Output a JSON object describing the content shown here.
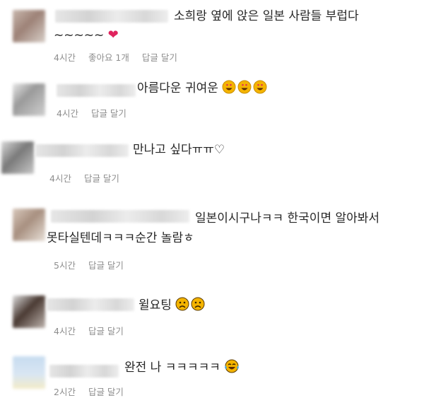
{
  "comments": [
    {
      "text_line1": "소희랑 옆에 앉은 일본 사람들 부럽다",
      "text_line2": "~~~~~",
      "emoji": "heart",
      "time": "4시간",
      "likes": "좋아요 1개",
      "reply": "답글 달기"
    },
    {
      "text_line1": "아름다운 귀여운",
      "emoji": "heart-eyes x3",
      "time": "4시간",
      "reply": "답글 달기"
    },
    {
      "text_line1": "만나고 싶다ㅠㅠ♡",
      "time": "4시간",
      "reply": "답글 달기"
    },
    {
      "text_line1": "일본이시구나ㅋㅋ 한국이면 알아봐서",
      "text_line2": "못타실텐데ㅋㅋㅋ순간 놀람ㅎ",
      "time": "5시간",
      "reply": "답글 달기"
    },
    {
      "text_line1": "윌요팅",
      "emoji": "frown x2",
      "time": "4시간",
      "reply": "답글 달기"
    },
    {
      "text_line1": "완전 나 ㅋㅋㅋㅋㅋ",
      "emoji": "tears-of-joy",
      "time": "2시간",
      "reply": "답글 달기"
    }
  ]
}
